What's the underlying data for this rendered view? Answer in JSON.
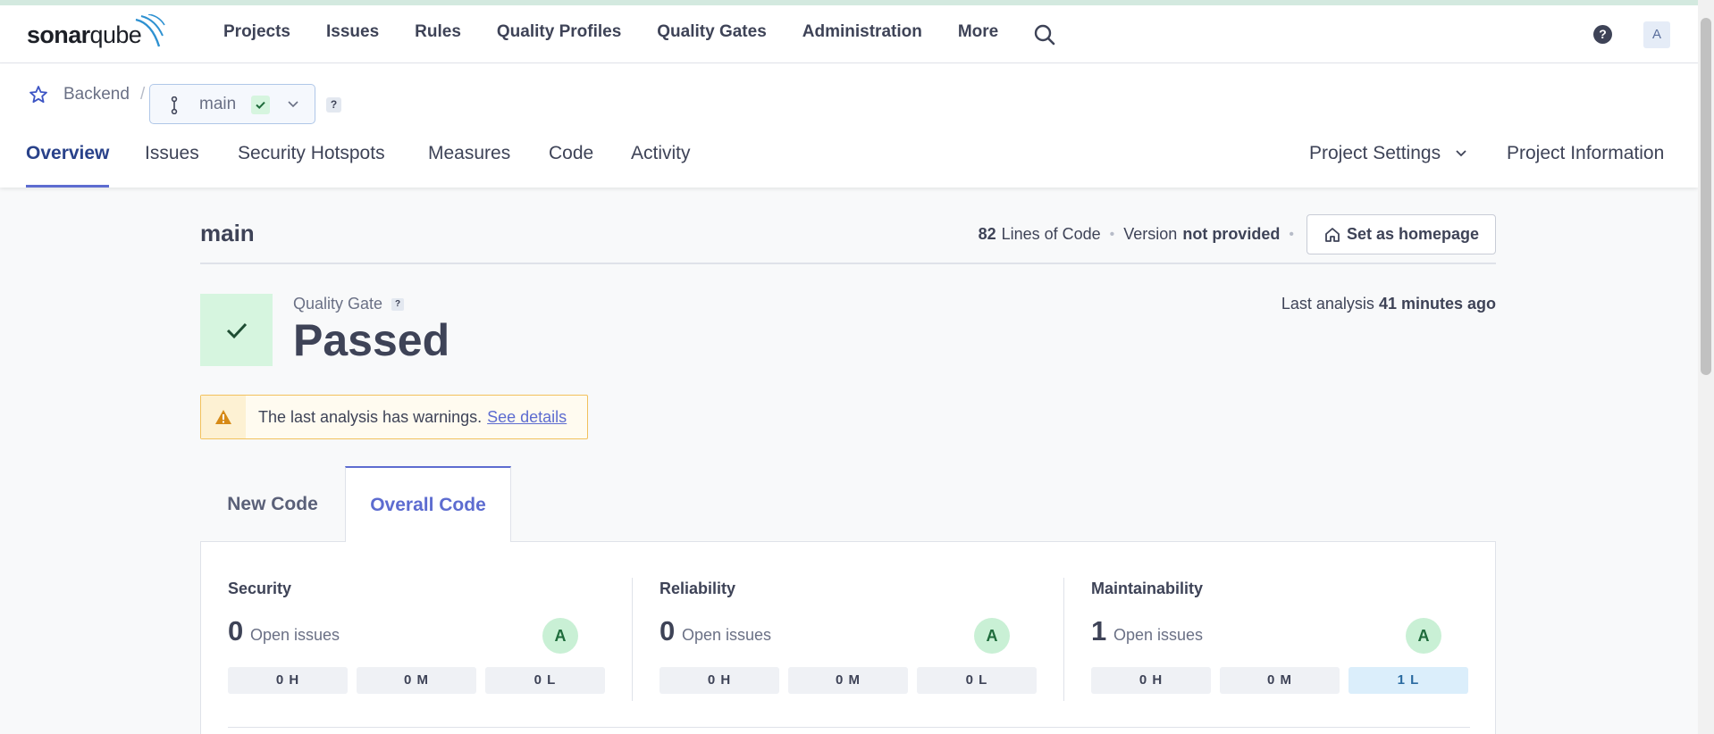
{
  "global_nav": {
    "logo": "sonarqube",
    "links": [
      "Projects",
      "Issues",
      "Rules",
      "Quality Profiles",
      "Quality Gates",
      "Administration",
      "More"
    ],
    "avatar": "A",
    "help": "?"
  },
  "project_header": {
    "project_name": "Backend",
    "separator": "/",
    "branch": "main",
    "branch_help": "?",
    "tabs": [
      "Overview",
      "Issues",
      "Security Hotspots",
      "Measures",
      "Code",
      "Activity"
    ],
    "right_tabs": [
      "Project Settings",
      "Project Information"
    ]
  },
  "main": {
    "title": "main",
    "loc_count": "82",
    "loc_label": "Lines of Code",
    "version_label": "Version",
    "version_value": "not provided",
    "home_button": "Set as homepage",
    "quality_gate_label": "Quality Gate",
    "quality_gate_help": "?",
    "quality_gate_status": "Passed",
    "last_analysis_label": "Last analysis",
    "last_analysis_value": "41 minutes ago",
    "warning_text": "The last analysis has warnings.",
    "warning_link": "See details",
    "code_tabs": [
      "New Code",
      "Overall Code"
    ],
    "measures": [
      {
        "title": "Security",
        "count": "0",
        "count_label": "Open issues",
        "rating": "A",
        "pills": [
          "0 H",
          "0 M",
          "0 L"
        ]
      },
      {
        "title": "Reliability",
        "count": "0",
        "count_label": "Open issues",
        "rating": "A",
        "pills": [
          "0 H",
          "0 M",
          "0 L"
        ]
      },
      {
        "title": "Maintainability",
        "count": "1",
        "count_label": "Open issues",
        "rating": "A",
        "pills": [
          "0 H",
          "0 M",
          "1 L"
        ]
      }
    ]
  },
  "colors": {
    "accent": "#5d6cd0",
    "passed_bg": "#d6f5df",
    "passed_check": "#1e6b3b",
    "warning_border": "#f2c15c"
  }
}
